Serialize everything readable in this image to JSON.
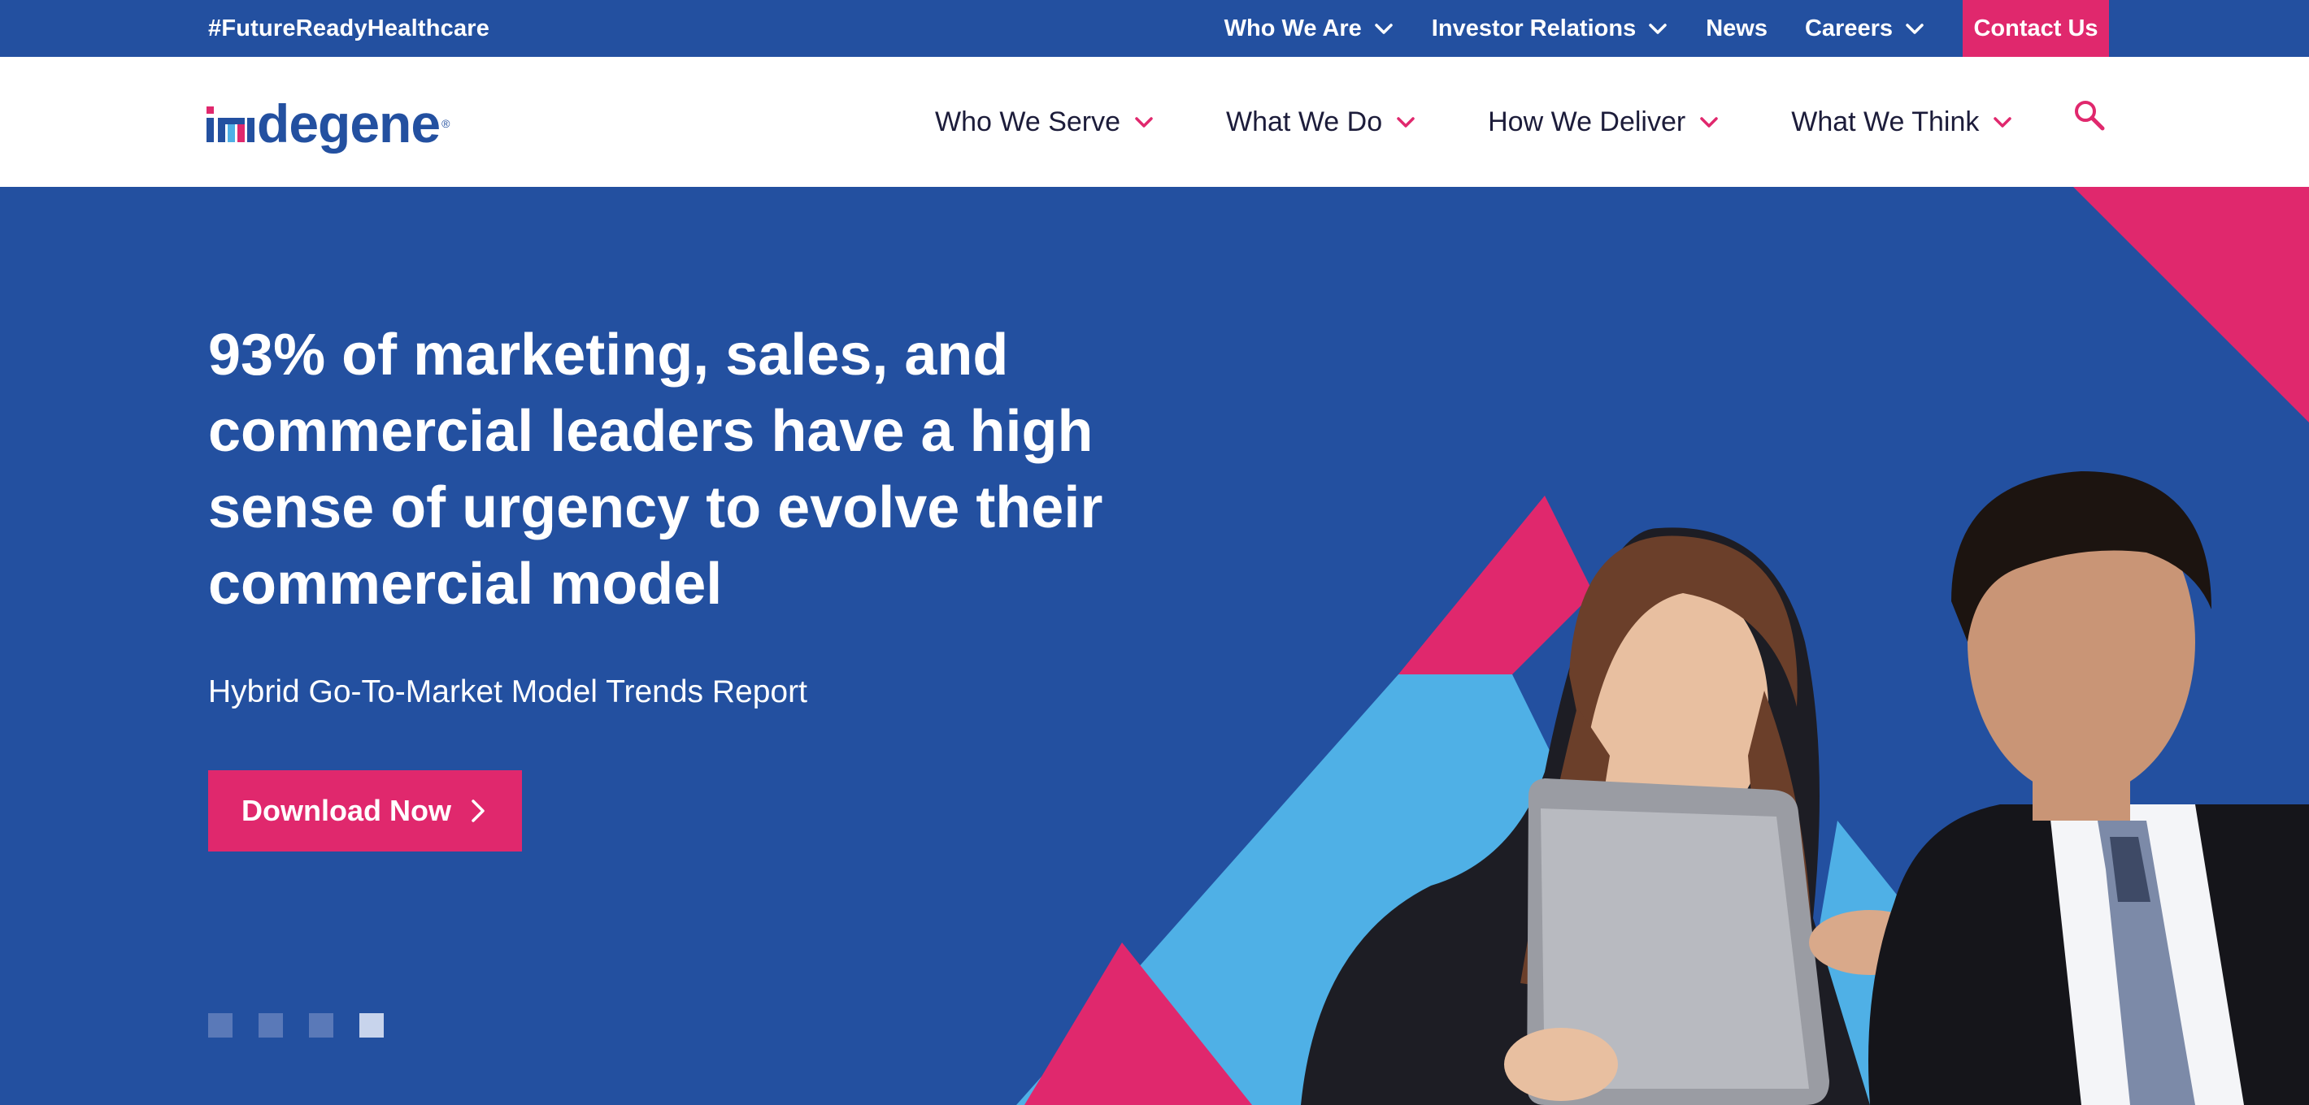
{
  "utility_bar": {
    "hashtag": "#FutureReadyHealthcare",
    "items": [
      {
        "label": "Who We Are",
        "has_dropdown": true
      },
      {
        "label": "Investor Relations",
        "has_dropdown": true
      },
      {
        "label": "News",
        "has_dropdown": false
      },
      {
        "label": "Careers",
        "has_dropdown": true
      }
    ],
    "contact_label": "Contact Us"
  },
  "header": {
    "logo_text": "degene",
    "logo_prefix": "i",
    "logo_reg": "®",
    "nav": [
      {
        "label": "Who We Serve"
      },
      {
        "label": "What We Do"
      },
      {
        "label": "How We Deliver"
      },
      {
        "label": "What We Think"
      }
    ],
    "search_icon": "search-icon"
  },
  "hero": {
    "headline": "93% of marketing, sales, and commercial leaders have a high sense of urgency to evolve their commercial model",
    "subtitle": "Hybrid Go-To-Market Model Trends Report",
    "cta_label": "Download Now",
    "slides_total": 4,
    "active_slide": 4
  },
  "colors": {
    "brand_blue": "#2350a0",
    "accent_pink": "#e0286d",
    "light_blue": "#4fb0e6"
  }
}
